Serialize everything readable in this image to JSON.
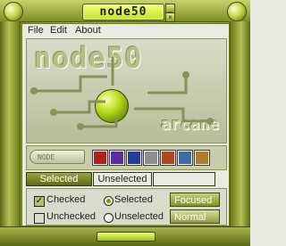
{
  "app": {
    "title": "node50"
  },
  "menu": {
    "file": "File",
    "edit": "Edit",
    "about": "About"
  },
  "banner": {
    "title": "node50",
    "subtitle": "arcane"
  },
  "tabs": {
    "selected": "Selected",
    "unselected": "Unselected"
  },
  "controls": {
    "checked": "Checked",
    "unchecked": "Unchecked",
    "radio_selected": "Selected",
    "radio_unselected": "Unselected",
    "focused": "Focused",
    "normal": "Normal"
  },
  "colors": {
    "accent": "#a8c92a",
    "dark": "#3f4a0c"
  }
}
